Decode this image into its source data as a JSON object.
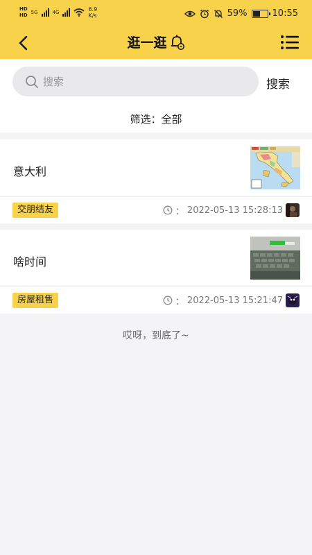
{
  "status_bar": {
    "hd1": "HD",
    "hd2": "HD",
    "network1": "5G",
    "network2": "4G",
    "speed_value": "6.9",
    "speed_unit": "K/s",
    "battery": "59%",
    "battery_level": 0.59,
    "time": "10:55"
  },
  "header": {
    "title": "逛一逛",
    "back_icon": "chevron-left-icon",
    "bell_icon": "bell-icon",
    "menu_icon": "list-menu-icon"
  },
  "search": {
    "placeholder": "搜索",
    "button_label": "搜索"
  },
  "filter": {
    "text": "筛选：全部"
  },
  "posts": [
    {
      "title": "意大利",
      "tag": "交朋结友",
      "time_prefix": "：",
      "time": "2022-05-13 15:28:13"
    },
    {
      "title": "啥时间",
      "tag": "房屋租售",
      "time_prefix": "：",
      "time": "2022-05-13 15:21:47"
    }
  ],
  "footer": {
    "text": "哎呀，到底了~"
  },
  "colors": {
    "accent": "#f7d24a",
    "background": "#f4f4f7"
  }
}
